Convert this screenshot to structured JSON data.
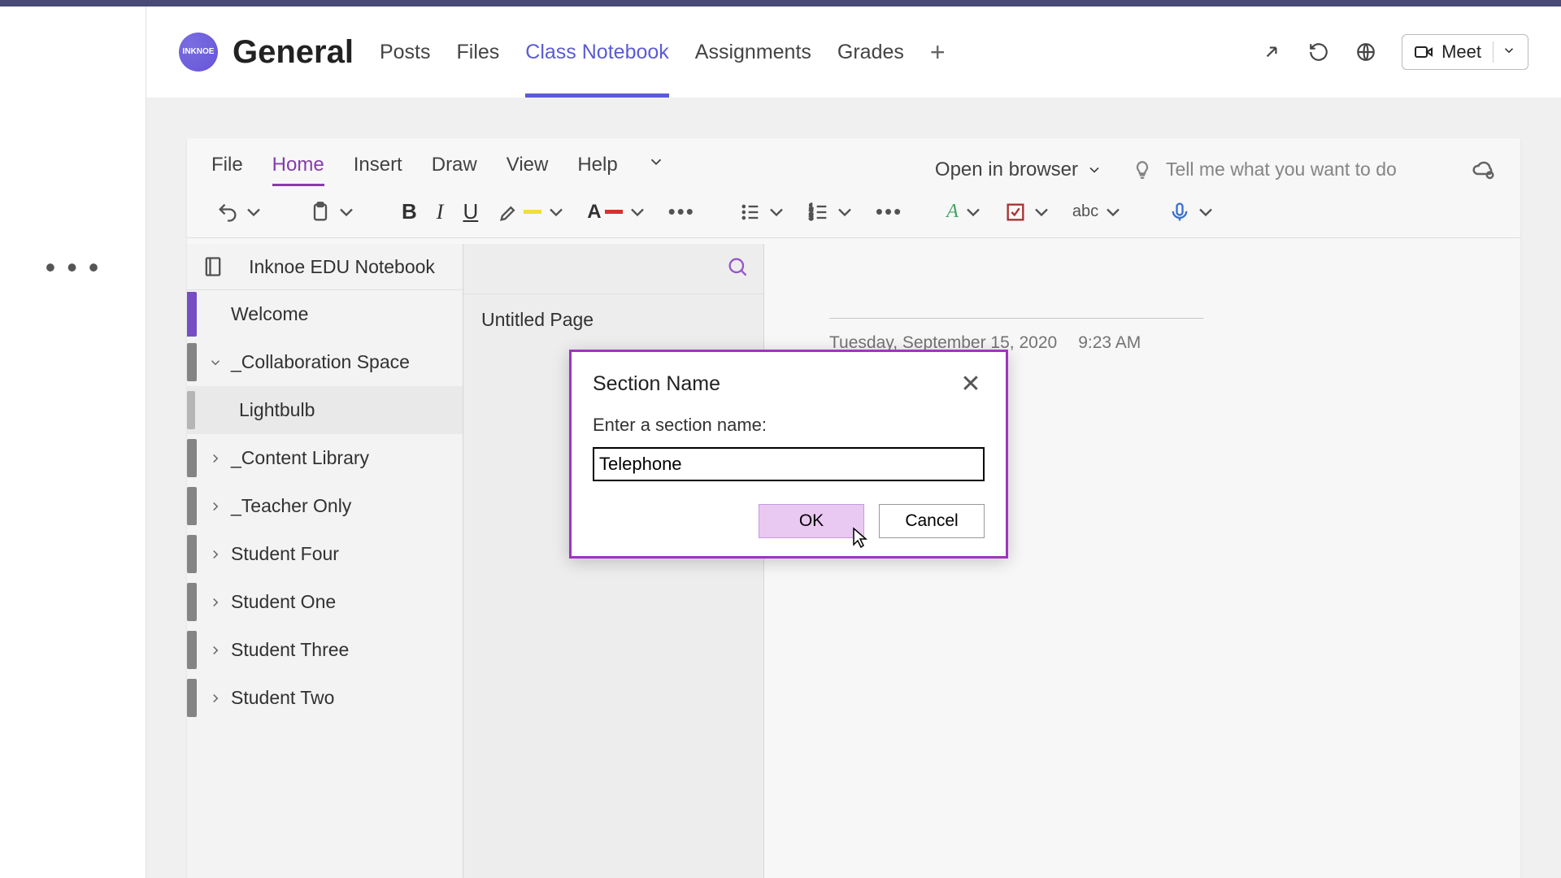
{
  "team": {
    "icon_text": "INKNOE",
    "title": "General"
  },
  "tabs": [
    {
      "label": "Posts",
      "active": false
    },
    {
      "label": "Files",
      "active": false
    },
    {
      "label": "Class Notebook",
      "active": true
    },
    {
      "label": "Assignments",
      "active": false
    },
    {
      "label": "Grades",
      "active": false
    }
  ],
  "meet_label": "Meet",
  "ribbon": {
    "tabs": [
      "File",
      "Home",
      "Insert",
      "Draw",
      "View",
      "Help"
    ],
    "active_index": 1,
    "open_browser": "Open in browser",
    "tell_me_placeholder": "Tell me what you want to do"
  },
  "notebook": {
    "title": "Inknoe EDU Notebook",
    "sections": [
      {
        "label": "Welcome",
        "expandable": false,
        "expanded": false,
        "kind": "welcome"
      },
      {
        "label": "_Collaboration Space",
        "expandable": true,
        "expanded": true
      },
      {
        "label": "Lightbulb",
        "child": true
      },
      {
        "label": "_Content Library",
        "expandable": true,
        "expanded": false
      },
      {
        "label": "_Teacher Only",
        "expandable": true,
        "expanded": false
      },
      {
        "label": "Student Four",
        "expandable": true,
        "expanded": false
      },
      {
        "label": "Student One",
        "expandable": true,
        "expanded": false
      },
      {
        "label": "Student Three",
        "expandable": true,
        "expanded": false
      },
      {
        "label": "Student Two",
        "expandable": true,
        "expanded": false
      }
    ],
    "page": "Untitled Page",
    "date": "Tuesday, September 15, 2020",
    "time": "9:23 AM"
  },
  "dialog": {
    "title": "Section Name",
    "label": "Enter a section name:",
    "value": "Telephone",
    "ok": "OK",
    "cancel": "Cancel"
  }
}
